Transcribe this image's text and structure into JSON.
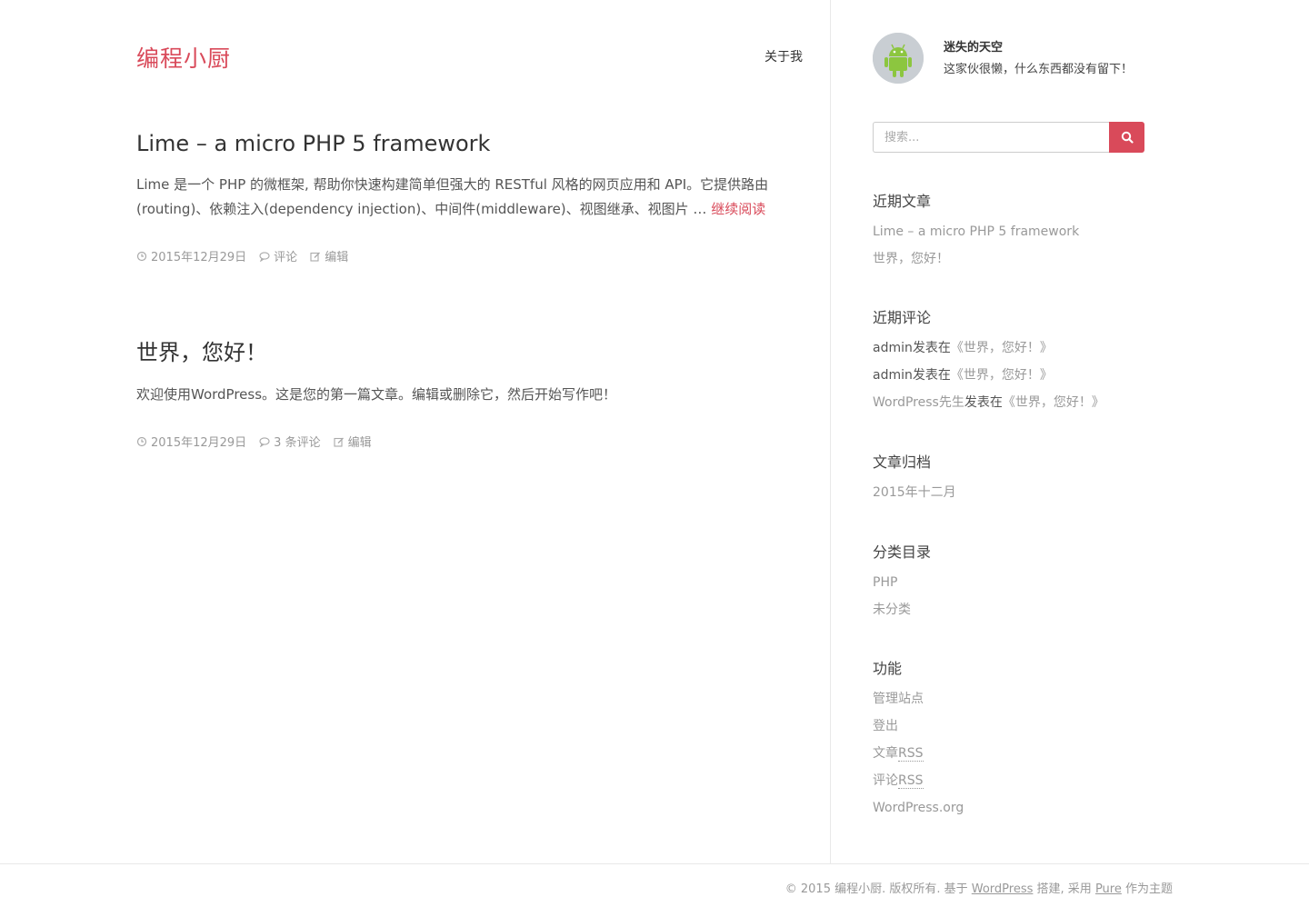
{
  "site": {
    "title": "编程小厨",
    "nav": {
      "about": "关于我"
    }
  },
  "posts": [
    {
      "title": "Lime – a micro PHP 5 framework",
      "excerpt": "Lime 是一个 PHP 的微框架, 帮助你快速构建简单但强大的 RESTful 风格的网页应用和 API。它提供路由(routing)、依赖注入(dependency injection)、中间件(middleware)、视图继承、视图片 … ",
      "read_more": "继续阅读",
      "date": "2015年12月29日",
      "comments": "评论",
      "edit": "编辑"
    },
    {
      "title": "世界，您好！",
      "excerpt": "欢迎使用WordPress。这是您的第一篇文章。编辑或删除它，然后开始写作吧！",
      "read_more": "",
      "date": "2015年12月29日",
      "comments": "3 条评论",
      "edit": "编辑"
    }
  ],
  "sidebar": {
    "author": {
      "name": "迷失的天空",
      "bio": "这家伙很懒，什么东西都没有留下！"
    },
    "search": {
      "placeholder": "搜索..."
    },
    "recent_posts": {
      "title": "近期文章",
      "items": [
        "Lime – a micro PHP 5 framework",
        "世界，您好！"
      ]
    },
    "recent_comments": {
      "title": "近期评论",
      "items": [
        {
          "author": "admin",
          "verb": "发表在",
          "post": "《世界，您好！》"
        },
        {
          "author": "admin",
          "verb": "发表在",
          "post": "《世界，您好！》"
        },
        {
          "author": "WordPress先生",
          "verb": "发表在",
          "post": "《世界，您好！》"
        }
      ]
    },
    "archives": {
      "title": "文章归档",
      "items": [
        "2015年十二月"
      ]
    },
    "categories": {
      "title": "分类目录",
      "items": [
        "PHP",
        "未分类"
      ]
    },
    "meta": {
      "title": "功能",
      "items": {
        "admin": "管理站点",
        "logout": "登出",
        "entries_prefix": "文章",
        "entries_rss": "RSS",
        "comments_prefix": "评论",
        "comments_rss": "RSS",
        "wporg": "WordPress.org"
      }
    }
  },
  "footer": {
    "copyright": "© 2015 编程小厨. 版权所有. 基于 ",
    "wordpress": "WordPress",
    "mid": " 搭建, 采用 ",
    "theme": "Pure",
    "end": " 作为主题"
  },
  "colors": {
    "accent": "#d94a5a",
    "muted": "#999999",
    "text": "#555555"
  }
}
